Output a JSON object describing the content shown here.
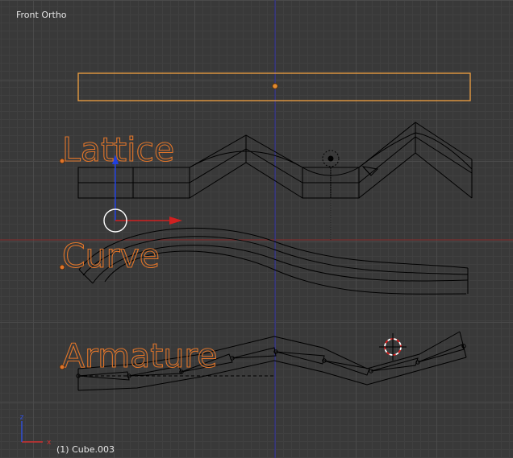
{
  "viewport": {
    "view_name": "Front Ortho",
    "object_info": "(1) Cube.003"
  },
  "labels": {
    "lattice": "Lattice",
    "curve": "Curve",
    "armature": "Armature"
  },
  "gizmo_axes": {
    "x": "x",
    "z": "z"
  },
  "colors": {
    "background": "#393939",
    "grid": "#4a4a4a",
    "wire": "#000000",
    "selected": "#f0a040",
    "label_outline": "#e0752a",
    "x_axis": "#b02020",
    "z_axis": "#2020b0",
    "manipulator_x": "#d02020",
    "manipulator_z": "#2040e0"
  }
}
